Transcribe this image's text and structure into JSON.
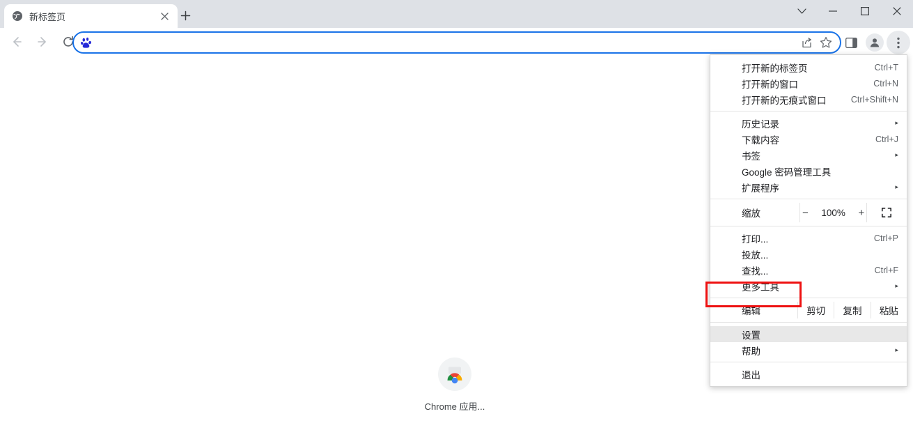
{
  "window": {
    "controls": [
      {
        "name": "tab-search",
        "glyph": "chevron-down"
      },
      {
        "name": "minimize",
        "glyph": "minimize"
      },
      {
        "name": "maximize",
        "glyph": "maximize"
      },
      {
        "name": "close",
        "glyph": "close"
      }
    ]
  },
  "tabstrip": {
    "background": "#dee1e6",
    "tab": {
      "title": "新标签页",
      "favicon": "globe-icon",
      "close_label": "×"
    },
    "new_tab_label": "+"
  },
  "toolbar": {
    "back_label": "←",
    "forward_label": "→",
    "reload_label": "↻",
    "omnibox": {
      "value": "",
      "placeholder": "",
      "site_icon": "baidu-paw-icon",
      "share_icon": "share-icon",
      "bookmark_icon": "star-icon"
    },
    "side_panel_icon": "side-panel-icon",
    "profile_icon": "avatar-icon",
    "menu_icon": "three-dot-menu-icon"
  },
  "content": {
    "shortcut": {
      "label": "Chrome 应用...",
      "icon": "chrome-apps-icon"
    }
  },
  "menu": {
    "accent": "#e8e8e8",
    "highlight_color": "#ee1111",
    "groups": [
      {
        "items": [
          {
            "label": "打开新的标签页",
            "accel": "Ctrl+T",
            "arrow": false
          },
          {
            "label": "打开新的窗口",
            "accel": "Ctrl+N",
            "arrow": false
          },
          {
            "label": "打开新的无痕式窗口",
            "accel": "Ctrl+Shift+N",
            "arrow": false
          }
        ]
      },
      {
        "items": [
          {
            "label": "历史记录",
            "accel": "",
            "arrow": true
          },
          {
            "label": "下载内容",
            "accel": "Ctrl+J",
            "arrow": false
          },
          {
            "label": "书签",
            "accel": "",
            "arrow": true
          },
          {
            "label": "Google 密码管理工具",
            "accel": "",
            "arrow": false
          },
          {
            "label": "扩展程序",
            "accel": "",
            "arrow": true
          }
        ]
      }
    ],
    "zoom_row": {
      "label": "缩放",
      "minus": "−",
      "value": "100%",
      "plus": "+",
      "fullscreen_icon": "fullscreen-icon"
    },
    "tools_group": [
      {
        "label": "打印...",
        "accel": "Ctrl+P",
        "arrow": false
      },
      {
        "label": "投放...",
        "accel": "",
        "arrow": false
      },
      {
        "label": "查找...",
        "accel": "Ctrl+F",
        "arrow": false
      },
      {
        "label": "更多工具",
        "accel": "",
        "arrow": true
      }
    ],
    "edit_row": {
      "label": "编辑",
      "cut": "剪切",
      "copy": "复制",
      "paste": "粘贴"
    },
    "settings_group": [
      {
        "label": "设置",
        "accel": "",
        "arrow": false,
        "highlighted": true
      },
      {
        "label": "帮助",
        "accel": "",
        "arrow": true,
        "highlighted": false
      }
    ],
    "exit_group": [
      {
        "label": "退出",
        "accel": "",
        "arrow": false
      }
    ]
  }
}
